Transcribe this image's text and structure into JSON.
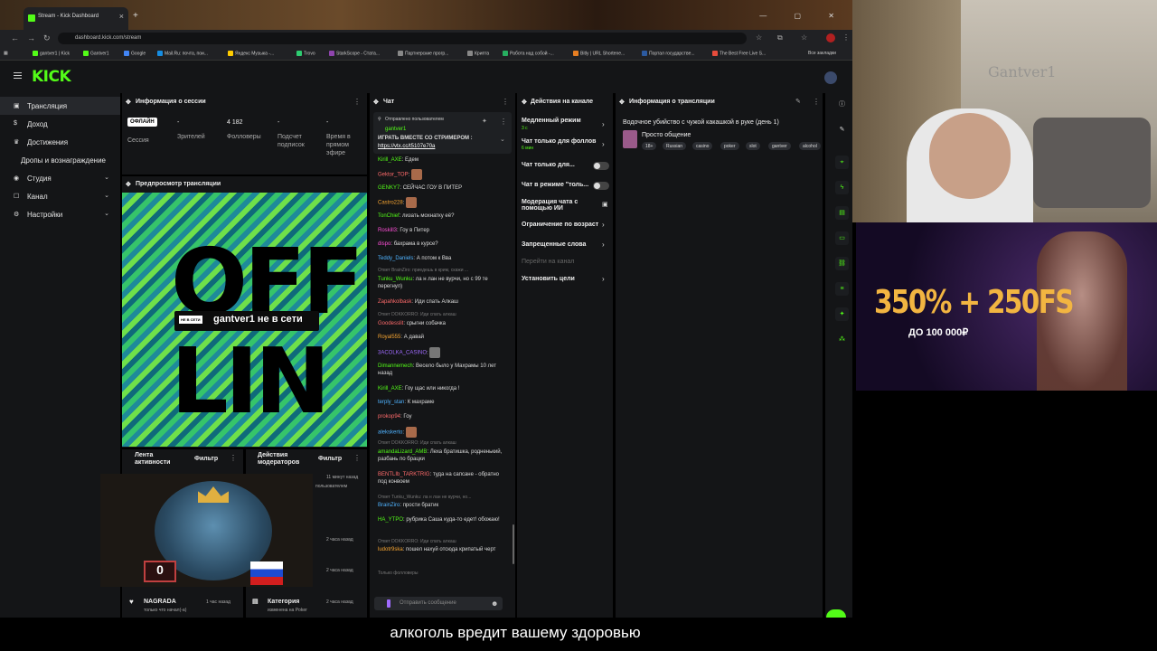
{
  "browser": {
    "tab_title": "Stream - Kick Dashboard",
    "new_tab": "+",
    "url": "dashboard.kick.com/stream",
    "window_controls": "— ▢ ✕",
    "bookmarks": [
      "gantver1 | Kick",
      "Gantver1",
      "Google",
      "Mail.Ru: почта, пои...",
      "Яндекс Музыка -...",
      "Trovo",
      "StarkScope - Стата...",
      "Партнерские прогр...",
      "Крипта",
      "Работа над собой -...",
      "Bitly | URL Shortene...",
      "Портал государстве...",
      "The Best Free Live S...",
      "Все закладки"
    ]
  },
  "header": {
    "logo": "KICK"
  },
  "sidebar": {
    "items": [
      {
        "label": "Трансляция",
        "icon": "broadcast-icon"
      },
      {
        "label": "Доход",
        "icon": "money-icon"
      },
      {
        "label": "Достижения",
        "icon": "trophy-icon"
      },
      {
        "label": "Дропы и вознаграждение"
      },
      {
        "label": "Студия",
        "icon": "studio-icon"
      },
      {
        "label": "Канал",
        "icon": "channel-icon"
      },
      {
        "label": "Настройки",
        "icon": "settings-icon"
      }
    ]
  },
  "session": {
    "title": "Информация о сессии",
    "badge": "ОФЛАЙН",
    "session_label": "Сессия",
    "viewers_val": "-",
    "viewers_label": "Зрителей",
    "followers_val": "4 182",
    "followers_label": "Фолловеры",
    "subs_val": "-",
    "subs_label": "Подсчет подписок",
    "time_val": "-",
    "time_label": "Время в прямом эфире"
  },
  "preview": {
    "title": "Предпросмотр трансляции",
    "big_top": "OFF",
    "big_bottom": "LIN",
    "tag": "НЕ В СЕТИ",
    "text": "gantver1 не в сети"
  },
  "activity": {
    "title": "Лента активности",
    "filter": "Фильтр",
    "mod_title": "Действия модераторов",
    "mod_filter": "Фильтр",
    "items": [
      {
        "text": "11 минут назад"
      },
      {
        "text": "пользователем"
      },
      {
        "text": "2 часа назад"
      },
      {
        "text": "2 часа назад"
      }
    ],
    "nagrada_name": "NAGRADA",
    "nagrada_time": "1 час назад",
    "nagrada_text": "только что начал(-а)",
    "category_title": "Категория",
    "category_text": "изменена на Poker",
    "category_time": "2 часа назад",
    "coin_value": "0"
  },
  "chat": {
    "title": "Чат",
    "pinned_header": "Отправлено пользователем",
    "pinned_user": "gantver1",
    "pinned_text": "ИГРАТЬ ВМЕСТЕ СО СТРИМЕРОМ :",
    "pinned_link": "https://vtx.cc/t5107e70a",
    "messages": [
      {
        "user": "Kirill_AXE",
        "color": "#53fc18",
        "text": "Едем"
      },
      {
        "user": "Gektor_TOP",
        "color": "#ff6b6b",
        "text": ""
      },
      {
        "user": "GENKY7",
        "color": "#53fc18",
        "text": "СЕЙЧАС ГОУ В ПИТЕР"
      },
      {
        "user": "Castro228",
        "color": "#f7a531",
        "text": ""
      },
      {
        "user": "TonChief",
        "color": "#53fc18",
        "text": "лизать мохнатку её?"
      },
      {
        "user": "Roskill3",
        "color": "#ff4fd8",
        "text": "Гоу в Питер"
      },
      {
        "user": "dispo",
        "color": "#ff4fd8",
        "text": "бахрама в курсе?"
      },
      {
        "user": "Teddy_Daniels",
        "color": "#4fb3ff",
        "text": "А потом к Вва"
      },
      {
        "user": "Tunku_Wunku",
        "color": "#53fc18",
        "text": "ла н лан не вурчи, но с 99 те перегнул)"
      },
      {
        "user": "Zapahkolbask",
        "color": "#ff6b6b",
        "text": "Иди спать Алкаш"
      },
      {
        "user": "Goodesslit",
        "color": "#ff6b6b",
        "text": "срыгни собачка"
      },
      {
        "user": "Royal555",
        "color": "#f7a531",
        "text": "А давай"
      },
      {
        "user": "3ACOLKA_CASINO",
        "color": "#a06bff",
        "text": ""
      },
      {
        "user": "Dimannemech",
        "color": "#53fc18",
        "text": "Весело было у Махрамы 10 лет назад"
      },
      {
        "user": "Kirill_AXE",
        "color": "#53fc18",
        "text": "Гоу щас или никогда !"
      },
      {
        "user": "terply_stan",
        "color": "#4fb3ff",
        "text": "К махраме"
      },
      {
        "user": "prokop94",
        "color": "#ff6b6b",
        "text": "Гоу"
      },
      {
        "user": "alekskerto",
        "color": "#4fb3ff",
        "text": ""
      },
      {
        "user": "amandaLizard_AMB",
        "color": "#53fc18",
        "text": "Леха братишка, родненький, разбань по брацки"
      },
      {
        "user": "BENTLIb_TARKTRIG",
        "color": "#ff6b6b",
        "text": "туда на сапсане - обратно под конвоем"
      },
      {
        "user": "BrainZiro",
        "color": "#4fb3ff",
        "text": "прости братик"
      },
      {
        "user": "HA_YTPO",
        "color": "#53fc18",
        "text": "рубрика Саша куда-то едет! обожаю!"
      },
      {
        "user": "ludotr9ska",
        "color": "#f7a531",
        "text": "пошел нахуй отсюда крипатый черт"
      }
    ],
    "replies": [
      "Ответ BrainZiro: приедешь в крим, скажи ...",
      "Ответ DOKKORRO: Иди спать алкаш",
      "Ответ DOKKORRO: Иди спать алкаш",
      "Ответ Tunku_Wunku: ла н лан не вурчи, но...",
      "Ответ DOKKORRO: Иди спать алкаш"
    ],
    "followers_only": "Только фолловеры",
    "input_placeholder": "Отправить сообщение"
  },
  "actions": {
    "title": "Действия на канале",
    "items": [
      {
        "label": "Медленный режим",
        "sub": "3 с"
      },
      {
        "label": "Чат только для фоллов",
        "sub": "6 мин"
      },
      {
        "label": "Чат только для..."
      },
      {
        "label": "Чат в режиме \"толь..."
      },
      {
        "label": "Модерация чата с помощью ИИ"
      },
      {
        "label": "Ограничение по возраст"
      },
      {
        "label": "Запрещенные слова"
      },
      {
        "label": "Перейти на канал"
      },
      {
        "label": "Установить цели"
      }
    ]
  },
  "stream_info": {
    "title": "Информация о трансляции",
    "stream_title": "Водочное убийство с чужой какашкой в руке (день 1)",
    "category": "Просто общение",
    "tags": [
      "18+",
      "Russian",
      "casino",
      "poker",
      "slot",
      "gantver",
      "alcohol"
    ]
  },
  "overlay": {
    "ad_big": "350% + 250FS",
    "ad_small": "ДО 100 000₽",
    "cam_watermark": "Gantver1",
    "subtitle": "алкоголь вредит вашему здоровью"
  }
}
